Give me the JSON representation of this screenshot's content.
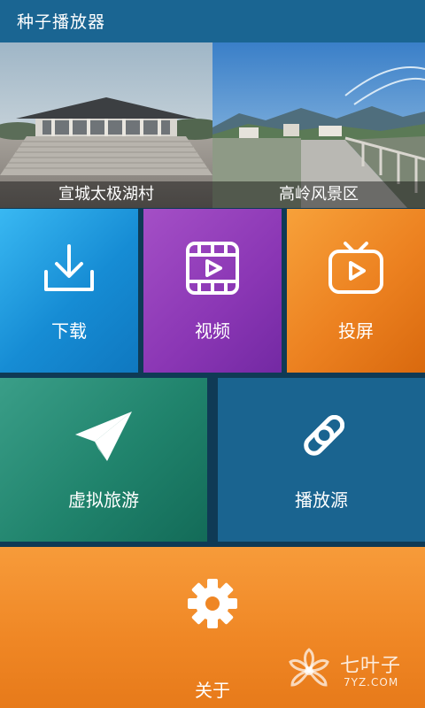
{
  "app": {
    "title": "种子播放器"
  },
  "banners": [
    {
      "caption": "宣城太极湖村"
    },
    {
      "caption": "高岭风景区"
    }
  ],
  "tiles": {
    "download": {
      "label": "下载",
      "icon": "download-icon",
      "color": "#168cd4"
    },
    "video": {
      "label": "视频",
      "icon": "film-play-icon",
      "color": "#8a36b4"
    },
    "cast": {
      "label": "投屏",
      "icon": "tv-play-icon",
      "color": "#ec8120"
    },
    "vtour": {
      "label": "虚拟旅游",
      "icon": "paper-plane-icon",
      "color": "#20836c"
    },
    "source": {
      "label": "播放源",
      "icon": "link-icon",
      "color": "#1a6490"
    },
    "about": {
      "label": "关于",
      "icon": "gear-icon",
      "color": "#ef8624"
    }
  },
  "watermark": {
    "name": "七叶子",
    "url": "7YZ.COM"
  }
}
